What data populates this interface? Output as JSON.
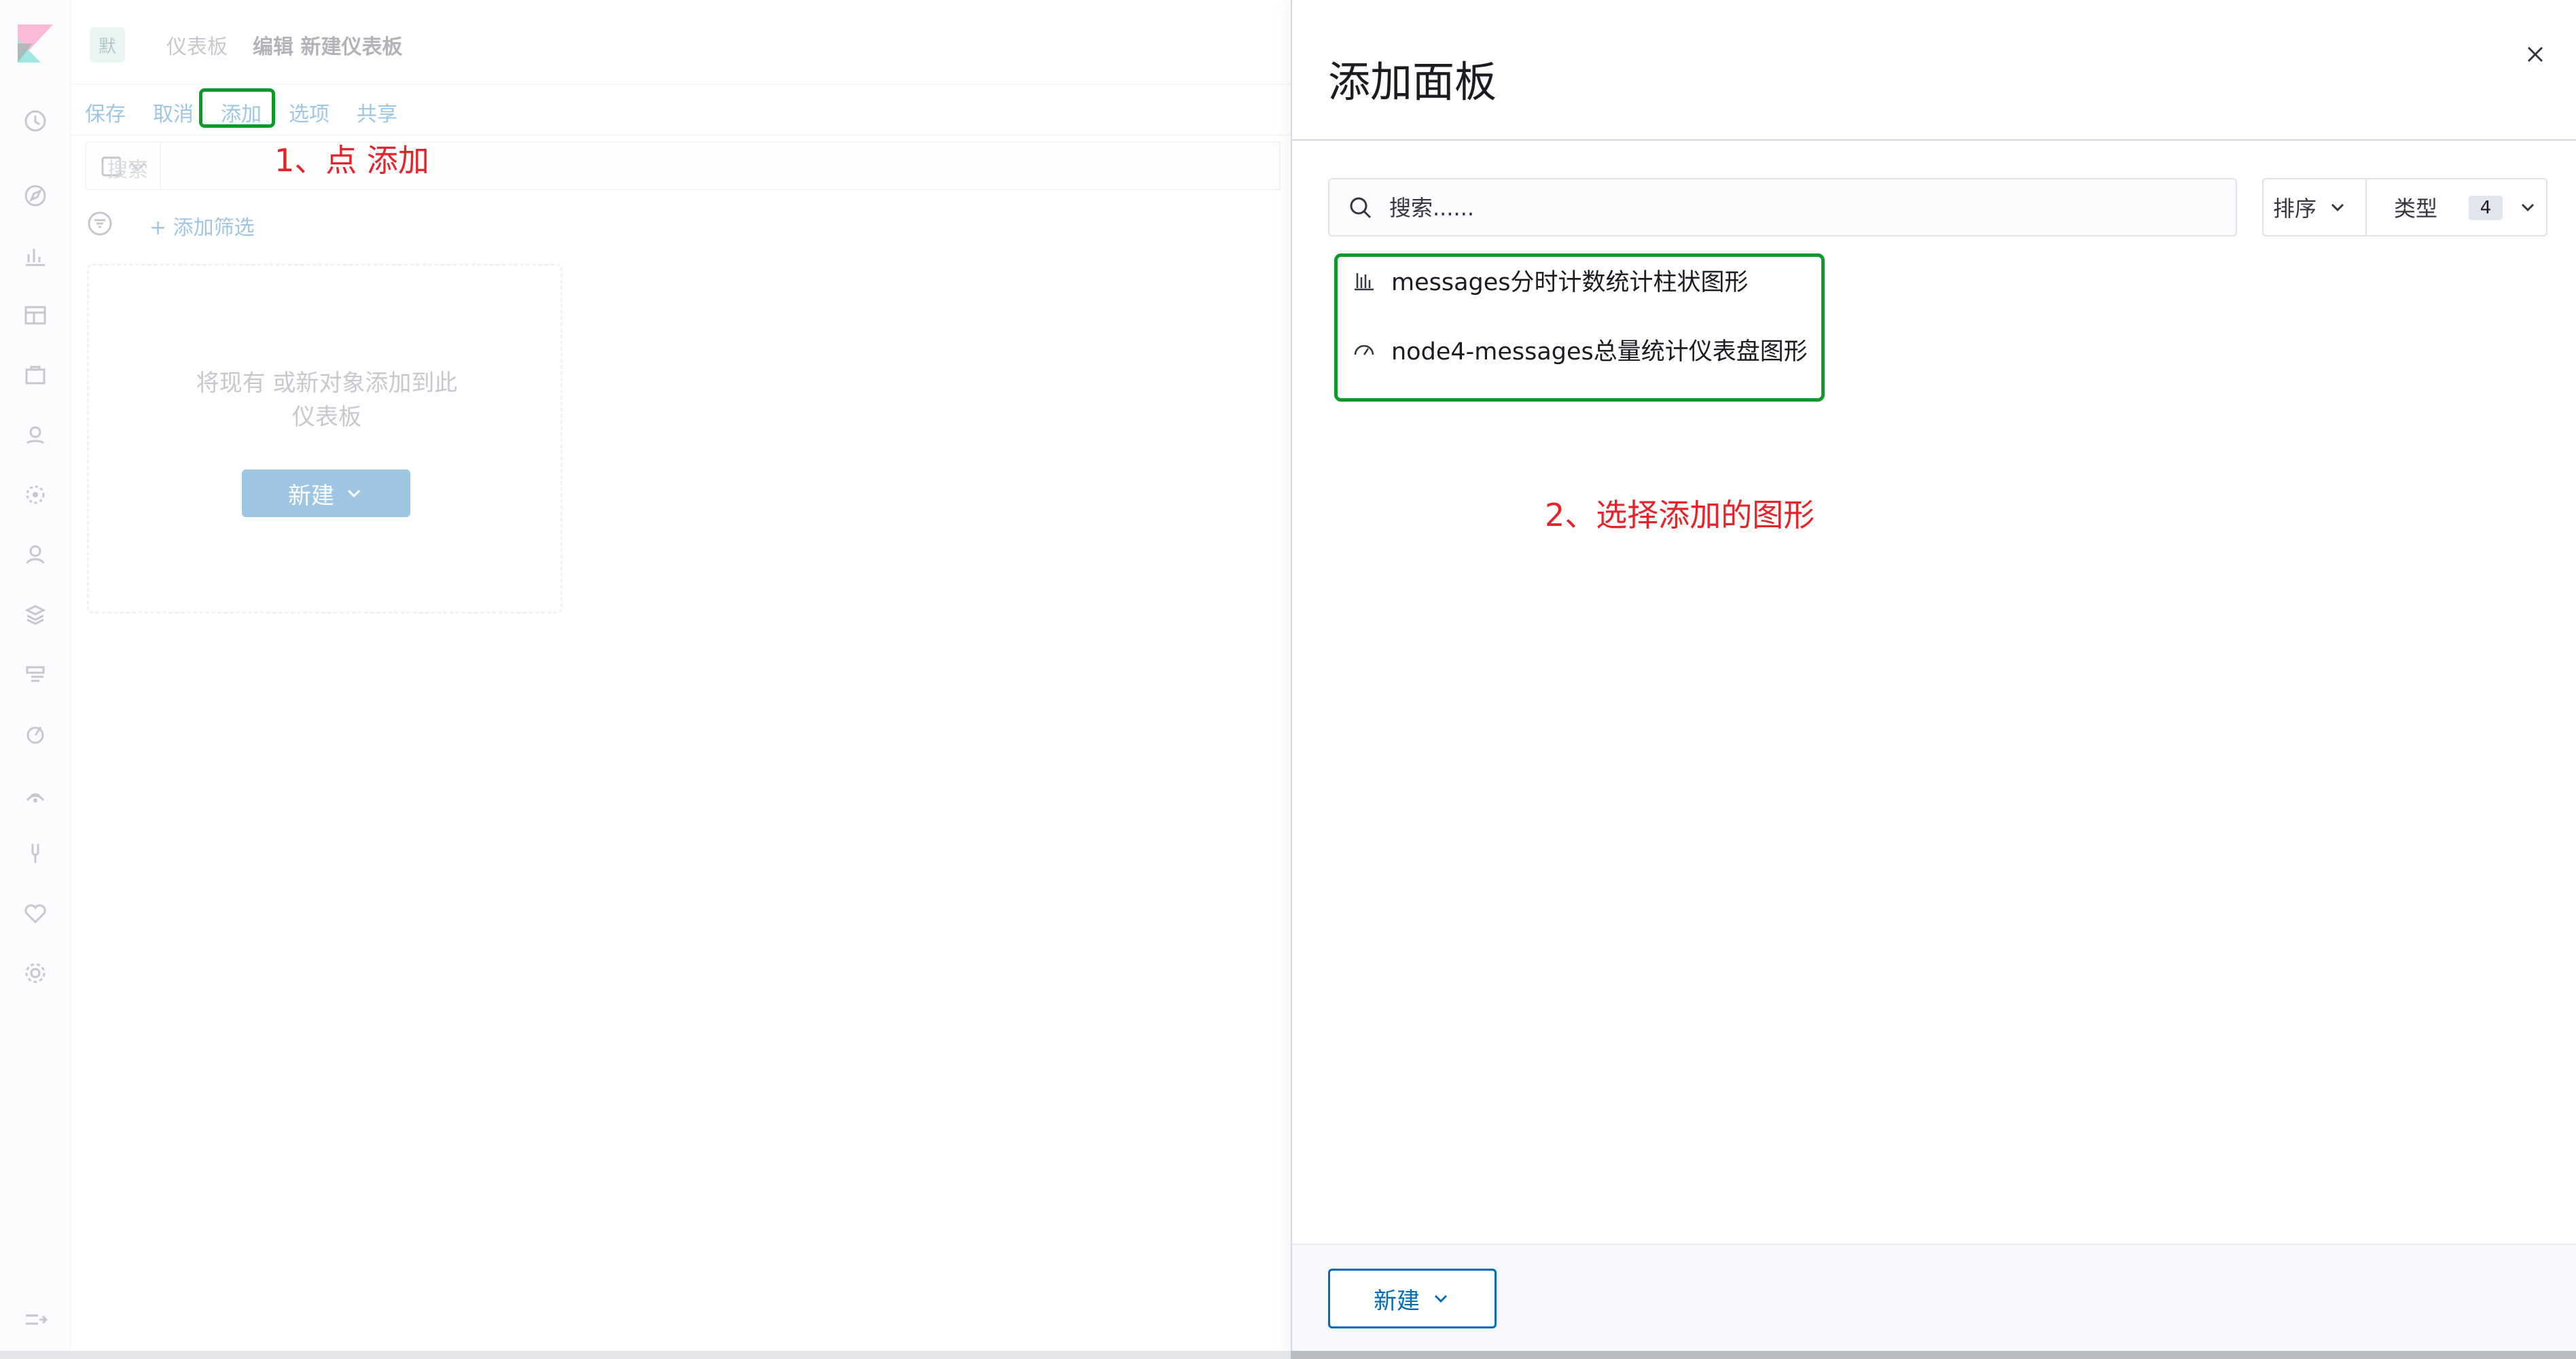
{
  "colors": {
    "accent": "#006bb4",
    "annotation_red": "#e3242b",
    "highlight_green": "#0e9a2a"
  },
  "nav": {
    "items": [
      "clock-icon",
      "compass-icon",
      "visualize-icon",
      "dashboard-icon",
      "canvas-icon",
      "maps-icon",
      "ml-icon",
      "siem-icon",
      "infrastructure-icon",
      "logs-icon",
      "apm-icon",
      "uptime-icon",
      "dev-tools-icon",
      "monitoring-icon",
      "management-icon",
      "collapse-icon"
    ]
  },
  "header": {
    "space_avatar": "默",
    "breadcrumb_root": "仪表板",
    "breadcrumb_current": "编辑 新建仪表板"
  },
  "menu": {
    "save": "保存",
    "cancel": "取消",
    "add": "添加",
    "options": "选项",
    "share": "共享"
  },
  "annotations": {
    "step1": "1、点 添加",
    "step2": "2、选择添加的图形"
  },
  "query": {
    "placeholder": "搜索",
    "add_filter": "+ 添加筛选"
  },
  "empty_panel": {
    "line1": "将现有 或新对象添加到此",
    "line2": "仪表板",
    "new_button": "新建"
  },
  "flyout": {
    "title": "添加面板",
    "search_placeholder": "搜索......",
    "sort_label": "排序",
    "type_label": "类型",
    "type_count": "4",
    "results": [
      {
        "icon": "bar-chart-icon",
        "label": "messages分时计数统计柱状图形"
      },
      {
        "icon": "gauge-icon",
        "label": "node4-messages总量统计仪表盘图形"
      }
    ],
    "new_button": "新建"
  }
}
